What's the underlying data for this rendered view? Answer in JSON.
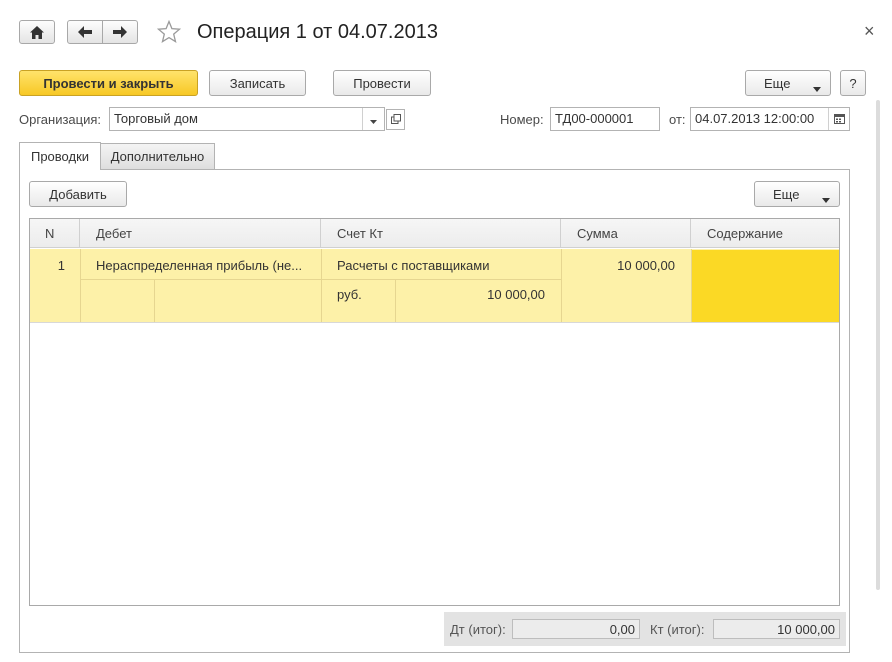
{
  "window": {
    "title": "Операция 1 от 04.07.2013",
    "close_glyph": "×"
  },
  "toolbar": {
    "post_and_close": "Провести и закрыть",
    "save": "Записать",
    "post": "Провести",
    "more": "Еще",
    "help": "?"
  },
  "header": {
    "organization_label": "Организация:",
    "organization_value": "Торговый дом",
    "number_label": "Номер:",
    "number_value": "ТД00-000001",
    "date_label": "от:",
    "date_value": "04.07.2013 12:00:00"
  },
  "tabs": [
    {
      "label": "Проводки",
      "active": true
    },
    {
      "label": "Дополнительно",
      "active": false
    }
  ],
  "table_toolbar": {
    "add": "Добавить",
    "more": "Еще"
  },
  "table": {
    "columns": [
      "N",
      "Дебет",
      "Счет Кт",
      "Сумма",
      "Содержание"
    ],
    "rows": [
      {
        "n": "1",
        "debit": "Нераспределенная прибыль (не...",
        "credit_account": "Расчеты с поставщиками",
        "sum": "10 000,00",
        "content": "",
        "credit_currency": "руб.",
        "credit_currency_sum": "10 000,00"
      }
    ]
  },
  "totals": {
    "dt_label": "Дт (итог):",
    "dt_value": "0,00",
    "kt_label": "Кт (итог):",
    "kt_value": "10 000,00"
  },
  "colors": {
    "primary_button": "#f7c825",
    "selected_row": "#fdf1a8",
    "active_cell": "#fbd925"
  }
}
